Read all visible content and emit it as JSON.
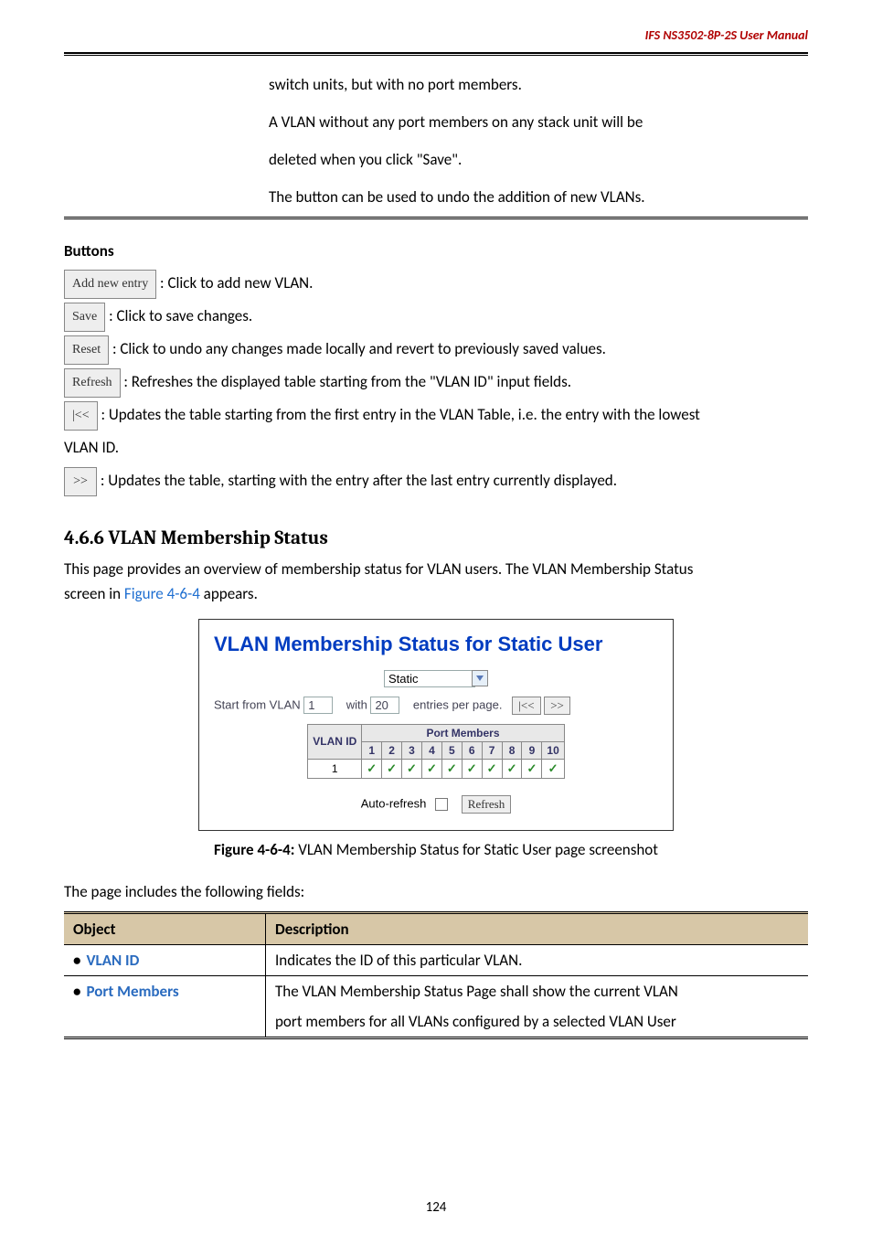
{
  "header": {
    "product": "IFS  NS3502-8P-2S  User  Manual"
  },
  "topdesc": {
    "l1": "switch units, but with no port members.",
    "l2": "A VLAN without any port members on any stack unit will be",
    "l3": "deleted when you click \"Save\".",
    "l4": "The button can be used to undo the addition of new VLANs."
  },
  "buttons": {
    "heading": "Buttons",
    "addnew_btn": "Add new entry",
    "addnew_txt": ": Click to add new VLAN.",
    "save_btn": "Save",
    "save_txt": ": Click to save changes.",
    "reset_btn": "Reset",
    "reset_txt": ": Click to undo any changes made locally and revert to previously saved values.",
    "refresh_btn": "Refresh",
    "refresh_txt": ": Refreshes the displayed table starting from the \"VLAN ID\" input fields.",
    "first_btn": "|<<",
    "first_txt": ": Updates the table starting from the first entry in the VLAN Table, i.e. the entry with the lowest",
    "vlanid": "VLAN ID.",
    "next_btn": ">>",
    "next_txt": ": Updates the table, starting with the entry after the last entry currently displayed."
  },
  "section": {
    "heading_full": "4.6.6 VLAN Membership Status",
    "intro1": "This page provides an overview of membership status for VLAN users. The VLAN Membership Status",
    "intro2a": "screen in ",
    "intro2b": "Figure 4-6-4",
    "intro2c": " appears."
  },
  "figure": {
    "title": "VLAN Membership Status for Static User",
    "selector": "Static",
    "row1_a": "Start from VLAN ",
    "row1_v1": "1",
    "row1_b": "with ",
    "row1_v2": "20",
    "row1_c": "entries per page.",
    "first_btn": "|<<",
    "next_btn": ">>",
    "port_members": "Port Members",
    "vlanid_hd": "VLAN ID",
    "ports": [
      "1",
      "2",
      "3",
      "4",
      "5",
      "6",
      "7",
      "8",
      "9",
      "10"
    ],
    "row_vlan": "1",
    "auto_label": "Auto-refresh",
    "refresh_btn": "Refresh"
  },
  "figcaption": {
    "b": "Figure 4-6-4:",
    "rest": " VLAN Membership Status for Static User page screenshot"
  },
  "fieldsintro": "The page includes the following fields:",
  "table": {
    "h1": "Object",
    "h2": "Description",
    "r1_obj": "VLAN ID",
    "r1_desc": "Indicates the ID of this particular VLAN.",
    "r2_obj": "Port Members",
    "r2_desc_l1": "The VLAN Membership Status Page shall show the current VLAN",
    "r2_desc_l2": "port members for all VLANs configured by a selected VLAN User"
  },
  "pagenum": "124",
  "chart_data": {
    "type": "table",
    "title": "VLAN Membership Status for Static User",
    "columns": [
      "VLAN ID",
      "Port 1",
      "Port 2",
      "Port 3",
      "Port 4",
      "Port 5",
      "Port 6",
      "Port 7",
      "Port 8",
      "Port 9",
      "Port 10"
    ],
    "rows": [
      {
        "VLAN ID": 1,
        "Port 1": true,
        "Port 2": true,
        "Port 3": true,
        "Port 4": true,
        "Port 5": true,
        "Port 6": true,
        "Port 7": true,
        "Port 8": true,
        "Port 9": true,
        "Port 10": true
      }
    ],
    "params": {
      "selector": "Static",
      "start_from_vlan": 1,
      "entries_per_page": 20,
      "auto_refresh": false
    }
  }
}
